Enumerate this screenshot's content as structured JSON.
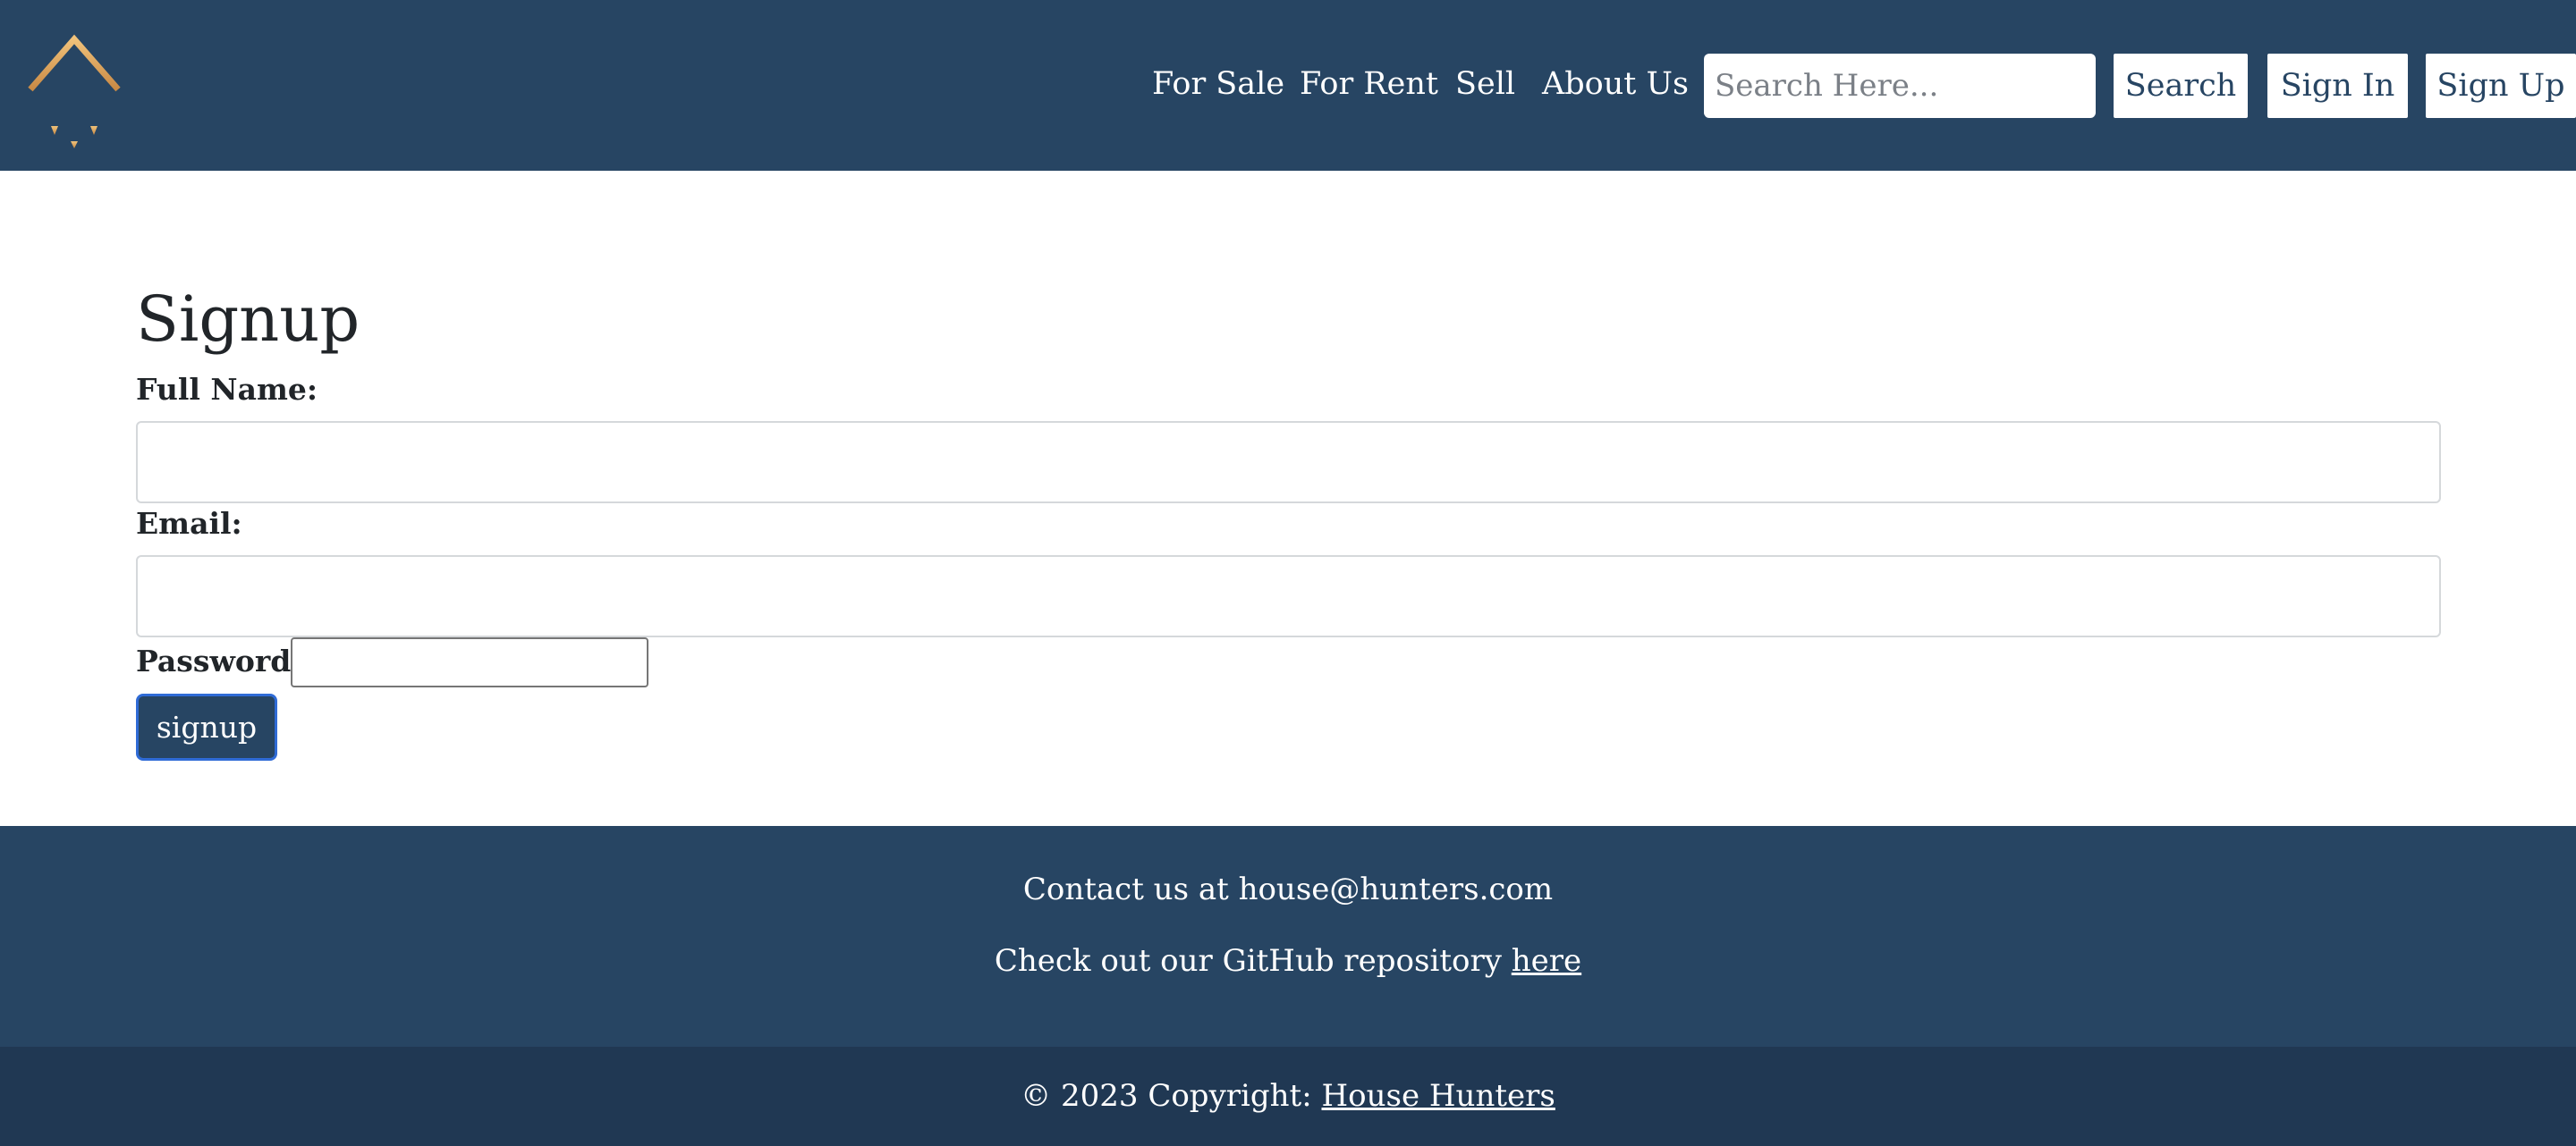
{
  "colors": {
    "navbar_bg": "#274563",
    "footer_bg": "#274563",
    "copyright_bg": "#203853",
    "logo_gold": "#e0a661",
    "signup_button_bg": "#274563",
    "signup_button_border": "#2f6bd6"
  },
  "header": {
    "logo_icon": "house-hunters-logo-icon",
    "nav": {
      "for_sale": "For Sale",
      "for_rent": "For Rent",
      "sell": "Sell",
      "about_us": "About Us"
    },
    "search": {
      "placeholder": "Search Here...",
      "value": "",
      "button_label": "Search"
    },
    "sign_in_label": "Sign In",
    "sign_up_label": "Sign Up"
  },
  "form": {
    "title": "Signup",
    "full_name_label": "Full Name:",
    "full_name_value": "",
    "email_label": "Email:",
    "email_value": "",
    "password_label": "Password:",
    "password_value": "",
    "submit_label": "signup"
  },
  "footer": {
    "contact_text": "Contact us at house@hunters.com",
    "github_text": "Check out our GitHub repository",
    "github_link_label": "here",
    "copyright_text": "© 2023 Copyright:",
    "copyright_link_label": "House Hunters"
  }
}
